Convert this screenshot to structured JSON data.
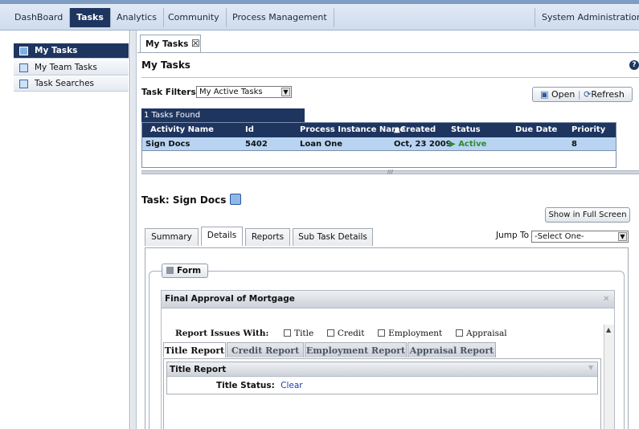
{
  "nav": {
    "tabs": [
      {
        "label": "DashBoard"
      },
      {
        "label": "Tasks"
      },
      {
        "label": "Analytics"
      },
      {
        "label": "Community"
      },
      {
        "label": "Process Management"
      },
      {
        "label": "System Administration"
      }
    ]
  },
  "sidebar": {
    "items": [
      {
        "label": "My Tasks"
      },
      {
        "label": "My Team Tasks"
      },
      {
        "label": "Task Searches"
      }
    ]
  },
  "tab_title": "My Tasks",
  "close_glyph": "☒",
  "help_glyph": "?",
  "page_title": "My Tasks",
  "filters": {
    "label": "Task Filters",
    "selected": "My Active Tasks",
    "open_label": "Open",
    "refresh_label": "Refresh"
  },
  "results": {
    "count_label": "1 Tasks Found",
    "columns": [
      "Activity Name",
      "Id",
      "Process Instance Name",
      "▲Created",
      "Status",
      "Due Date",
      "Priority"
    ],
    "rows": [
      {
        "activity": "Sign Docs",
        "id": "5402",
        "instance": "Loan One",
        "created": "Oct, 23 2009",
        "status": "Active",
        "due": "",
        "priority": "8"
      }
    ],
    "grip": "///"
  },
  "task": {
    "title": "Task: Sign Docs",
    "fullscreen_label": "Show in Full Screen",
    "tabs": [
      "Summary",
      "Details",
      "Reports",
      "Sub Task Details"
    ],
    "jump_label": "Jump To",
    "jump_selected": "-Select One-"
  },
  "form": {
    "legend": "Form",
    "panel_title": "Final Approval of Mortgage",
    "issues_label": "Report Issues With:",
    "issues": [
      "Title",
      "Credit",
      "Employment",
      "Appraisal"
    ],
    "report_tabs": [
      "Title Report",
      "Credit Report",
      "Employment Report",
      "Appraisal Report"
    ],
    "inner_title": "Title Report",
    "status_label": "Title Status:",
    "status_value": "Clear"
  },
  "colors": {
    "nav_active": "#1e3560",
    "grid_header": "#1e3560",
    "selected_row": "#b8d4f2",
    "active_status": "#2f8a2f",
    "link": "#1a3fb0"
  }
}
